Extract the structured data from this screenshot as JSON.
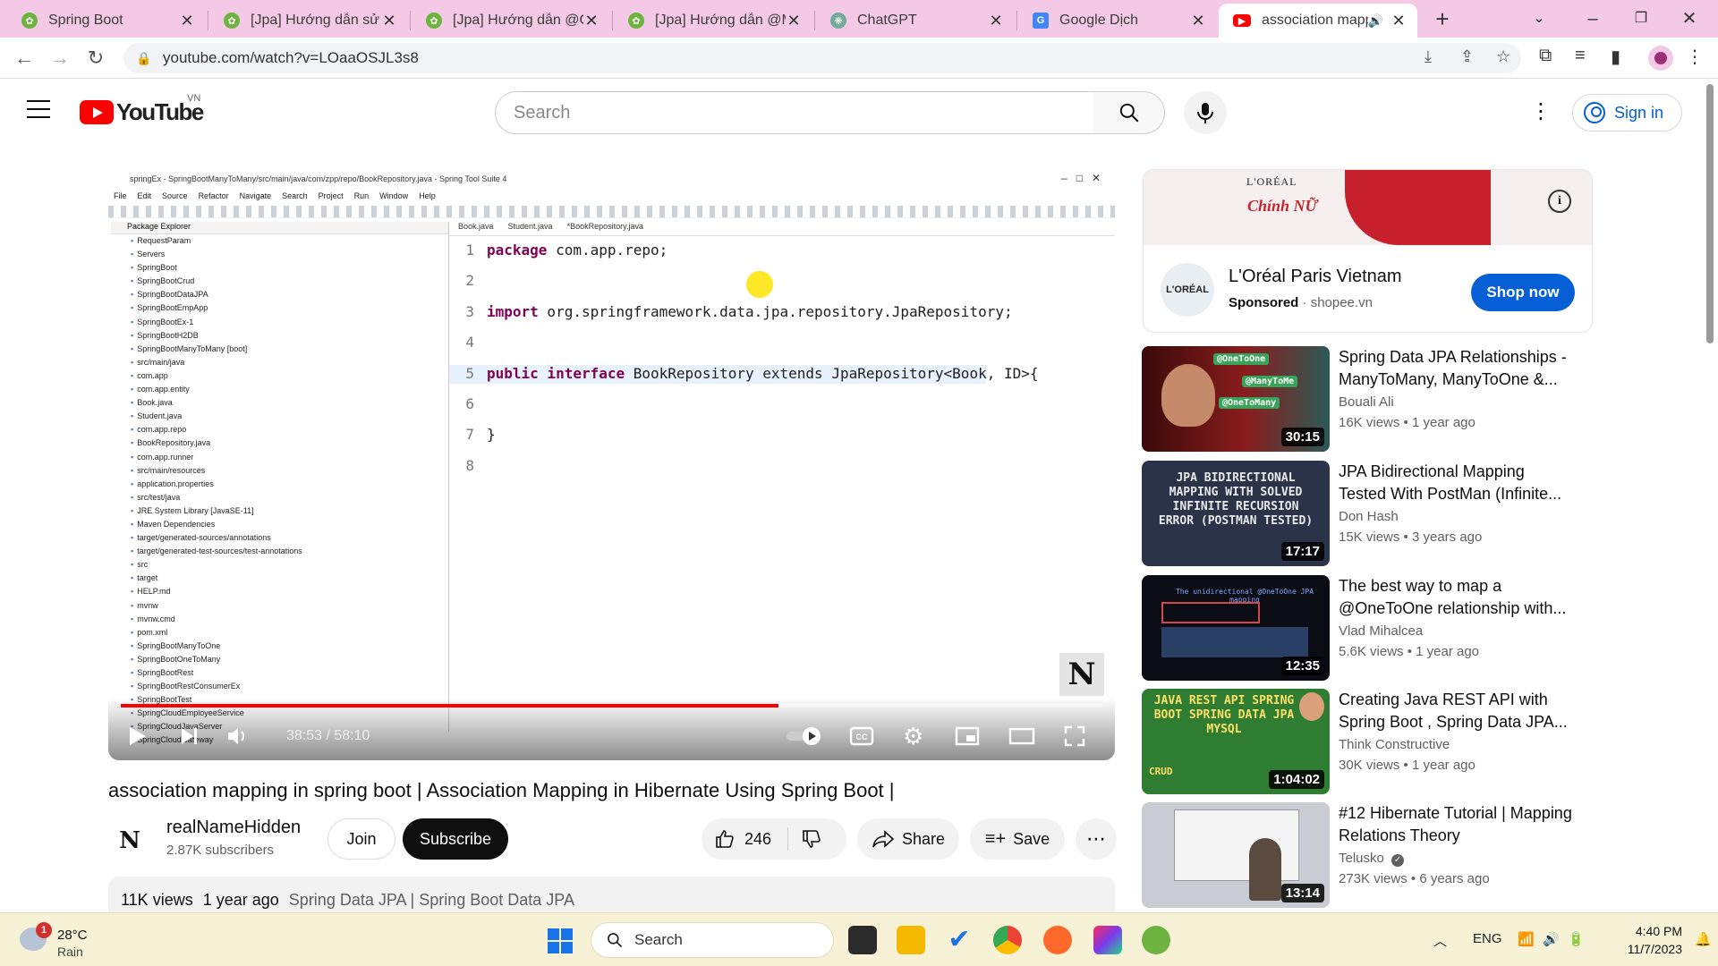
{
  "browser": {
    "tabs": [
      {
        "title": "Spring Boot",
        "favicon": "spring-icon"
      },
      {
        "title": "[Jpa] Hướng dẫn sử d",
        "favicon": "spring-icon"
      },
      {
        "title": "[Jpa] Hướng dẫn @O",
        "favicon": "spring-icon"
      },
      {
        "title": "[Jpa] Hướng dẫn @M",
        "favicon": "spring-icon"
      },
      {
        "title": "ChatGPT",
        "favicon": "chatgpt-icon"
      },
      {
        "title": "Google Dịch",
        "favicon": "google-translate-icon"
      },
      {
        "title": "association mapp",
        "favicon": "youtube-icon"
      }
    ],
    "url": "youtube.com/watch?v=LOaaOSJL3s8"
  },
  "youtube": {
    "logo": "YouTube",
    "region": "VN",
    "search_placeholder": "Search",
    "signin_label": "Sign in"
  },
  "video": {
    "ide_title": "springEx - SpringBootManyToMany/src/main/java/com/zpp/repo/BookRepository.java - Spring Tool Suite 4",
    "ide_menu": [
      "File",
      "Edit",
      "Source",
      "Refactor",
      "Navigate",
      "Search",
      "Project",
      "Run",
      "Window",
      "Help"
    ],
    "package_explorer_title": "Package Explorer",
    "tree": [
      "RequestParam",
      "Servers",
      "SpringBoot",
      "SpringBootCrud",
      "SpringBootDataJPA",
      "SpringBootEmpApp",
      "SpringBootEx-1",
      "SpringBootH2DB",
      "SpringBootManyToMany [boot]",
      "src/main/java",
      "com.app",
      "com.app.entity",
      "Book.java",
      "Student.java",
      "com.app.repo",
      "BookRepository.java",
      "com.app.runner",
      "src/main/resources",
      "application.properties",
      "src/test/java",
      "JRE System Library [JavaSE-11]",
      "Maven Dependencies",
      "target/generated-sources/annotations",
      "target/generated-test-sources/test-annotations",
      "src",
      "target",
      "HELP.md",
      "mvnw",
      "mvnw.cmd",
      "pom.xml",
      "SpringBootManyToOne",
      "SpringBootOneToMany",
      "SpringBootRest",
      "SpringBootRestConsumerEx",
      "SpringBootTest",
      "SpringCloudEmployeeService",
      "SpringCloudJavaServer",
      "SpringCloudGateway"
    ],
    "editor_tabs": [
      "Book.java",
      "Student.java",
      "*BookRepository.java"
    ],
    "code_lines": [
      {
        "n": "1",
        "kw": "package",
        "rest": " com.app.repo;"
      },
      {
        "n": "2",
        "kw": "",
        "rest": ""
      },
      {
        "n": "3",
        "kw": "import",
        "rest": " org.springframework.data.jpa.repository.JpaRepository;"
      },
      {
        "n": "4",
        "kw": "",
        "rest": ""
      },
      {
        "n": "5",
        "kw": "public interface",
        "rest": " BookRepository extends JpaRepository<Book, ID>{"
      },
      {
        "n": "6",
        "kw": "",
        "rest": ""
      },
      {
        "n": "7",
        "kw": "",
        "rest": "}"
      },
      {
        "n": "8",
        "kw": "",
        "rest": ""
      }
    ],
    "progress": 0.67,
    "time": "38:53 / 58:10",
    "title": "association mapping in spring boot | Association Mapping in Hibernate Using Spring Boot |",
    "channel": {
      "name": "realNameHidden",
      "subscribers": "2.87K subscribers",
      "avatar": "N"
    },
    "join_label": "Join",
    "subscribe_label": "Subscribe",
    "likes": "246",
    "share_label": "Share",
    "save_label": "Save",
    "views": "11K views",
    "age": "1 year ago",
    "tags": "Spring Data JPA | Spring Boot Data JPA"
  },
  "ad": {
    "banner_brand": "L'ORÉAL",
    "banner_promo": "Chính NỮ",
    "logo": "L'ORÉAL",
    "name": "L'Oréal Paris Vietnam",
    "sponsored": "Sponsored",
    "domain": "shopee.vn",
    "cta": "Shop now"
  },
  "recommendations": [
    {
      "title": "Spring Data JPA Relationships - ManyToMany, ManyToOne &...",
      "channel": "Bouali Ali",
      "views": "16K views",
      "age": "1 year ago",
      "duration": "30:15",
      "thumb_tags": [
        "@OneToOne",
        "@ManyToMe",
        "@OneToMany"
      ]
    },
    {
      "title": "JPA Bidirectional Mapping Tested With PostMan (Infinite...",
      "channel": "Don Hash",
      "views": "15K views",
      "age": "3 years ago",
      "duration": "17:17",
      "thumb_text": "JPA BIDIRECTIONAL MAPPING WITH SOLVED INFINITE RECURSION ERROR (POSTMAN TESTED)"
    },
    {
      "title": "The best way to map a @OneToOne relationship with...",
      "channel": "Vlad Mihalcea",
      "views": "5.6K views",
      "age": "1 year ago",
      "duration": "12:35",
      "thumb_text": "The unidirectional @OneToOne JPA mapping"
    },
    {
      "title": "Creating Java REST API with Spring Boot , Spring Data JPA...",
      "channel": "Think Constructive",
      "views": "30K views",
      "age": "1 year ago",
      "duration": "1:04:02",
      "thumb_text": "JAVA REST API SPRING BOOT SPRING DATA JPA MYSQL",
      "thumb_crud": "CRUD"
    },
    {
      "title": "#12 Hibernate Tutorial | Mapping Relations Theory",
      "channel": "Telusko",
      "views": "273K views",
      "age": "6 years ago",
      "duration": "13:14",
      "verified": true
    }
  ],
  "taskbar": {
    "weather_temp": "28°C",
    "weather_cond": "Rain",
    "weather_badge": "1",
    "search_label": "Search",
    "lang": "ENG",
    "time": "4:40 PM",
    "date": "11/7/2023"
  },
  "colors": {
    "youtube_red": "#ff0000",
    "link_blue": "#065fd4",
    "tab_bar": "#f4c9e6",
    "taskbar": "#f7f2d6"
  }
}
